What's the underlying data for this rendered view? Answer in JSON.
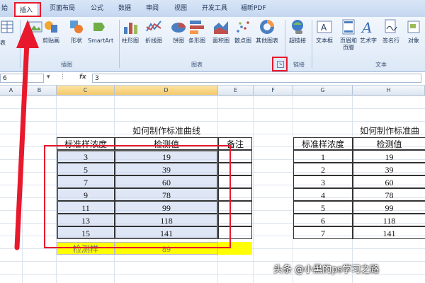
{
  "tabs": [
    "始",
    "插入",
    "页面布局",
    "公式",
    "数据",
    "审阅",
    "视图",
    "开发工具",
    "福昕PDF"
  ],
  "active_tab": "插入",
  "ribbon": {
    "left_partial": "表",
    "illustrations": {
      "label": "插图",
      "buttons": [
        "剪贴画",
        "形状",
        "SmartArt"
      ]
    },
    "charts": {
      "label": "图表",
      "buttons": [
        "柱形图",
        "折线图",
        "饼图",
        "条形图",
        "面积图",
        "散点图",
        "其他图表"
      ]
    },
    "links": {
      "label": "链接",
      "buttons": [
        "超链接"
      ]
    },
    "text": {
      "label": "文本",
      "buttons": [
        "文本框",
        "页眉和页脚",
        "艺术字",
        "签名行",
        "对象"
      ]
    }
  },
  "formula_bar": {
    "name_box": "6",
    "fx": "fx",
    "value": "3"
  },
  "columns": [
    {
      "label": "A"
    },
    {
      "label": "B"
    },
    {
      "label": "C"
    },
    {
      "label": "D"
    },
    {
      "label": "E"
    },
    {
      "label": "F"
    },
    {
      "label": "G"
    },
    {
      "label": "H"
    }
  ],
  "left_table": {
    "title": "如何制作标准曲线",
    "headers": [
      "标准样浓度",
      "检测值",
      "备注"
    ],
    "rows": [
      [
        "3",
        "19"
      ],
      [
        "5",
        "39"
      ],
      [
        "7",
        "60"
      ],
      [
        "9",
        "78"
      ],
      [
        "11",
        "99"
      ],
      [
        "13",
        "118"
      ],
      [
        "15",
        "141"
      ]
    ],
    "footer": [
      "检测样",
      "89"
    ]
  },
  "right_table": {
    "title": "如何制作标准曲",
    "headers": [
      "标准样浓度",
      "检测值"
    ],
    "rows": [
      [
        "1",
        "19"
      ],
      [
        "2",
        "39"
      ],
      [
        "3",
        "60"
      ],
      [
        "4",
        "78"
      ],
      [
        "5",
        "99"
      ],
      [
        "6",
        "118"
      ],
      [
        "7",
        "141"
      ]
    ]
  },
  "watermark": "头条 @小黑的ps学习之路",
  "colors": {
    "annotation_red": "#e8192c",
    "selection": "#c4d4ee",
    "highlight_yellow": "#ffff00"
  }
}
